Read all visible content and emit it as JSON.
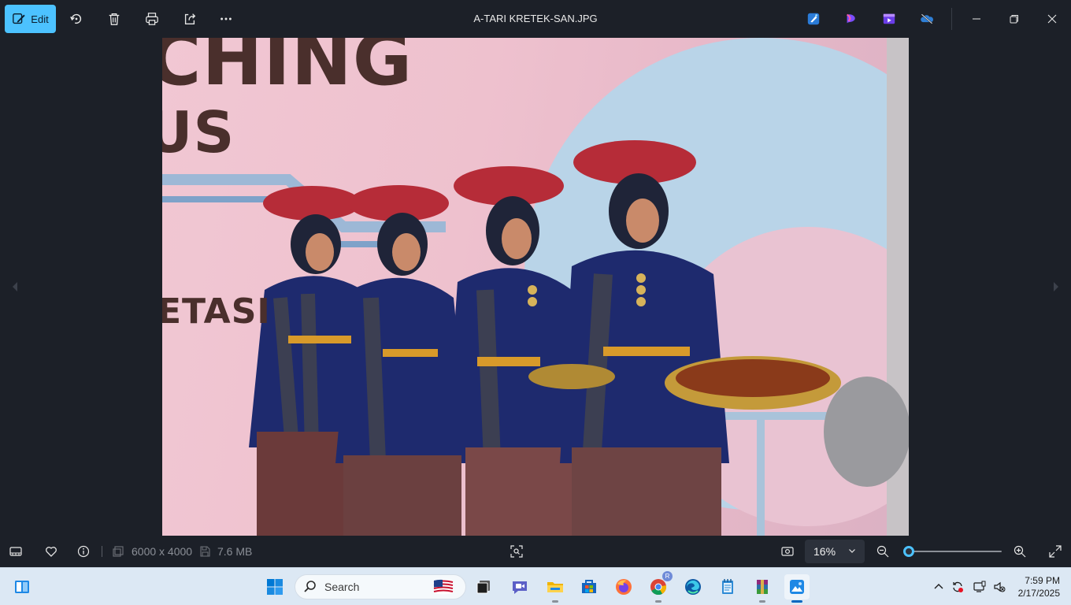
{
  "window": {
    "title": "A-TARI KRETEK-SAN.JPG",
    "edit_label": "Edit"
  },
  "toolbar": {
    "icons": [
      "edit-pencil-icon",
      "rotate-icon",
      "delete-icon",
      "print-icon",
      "share-icon",
      "more-icon"
    ]
  },
  "app_icons": [
    "designer-icon",
    "clipchamp-icon",
    "video-editor-icon",
    "onedrive-icon"
  ],
  "photo": {
    "banner_line1": "CHING",
    "banner_line2": "US",
    "banner_line3": "ETASI"
  },
  "status": {
    "dimensions": "6000 x 4000",
    "file_size": "7.6 MB",
    "zoom": "16%",
    "zoom_fraction": 0.02
  },
  "taskbar": {
    "search_placeholder": "Search",
    "chrome_badge": "R",
    "time": "7:59 PM",
    "date": "2/17/2025"
  },
  "colors": {
    "accent": "#4cc2ff",
    "background": "#1c2028",
    "taskbar": "#dce8f4"
  }
}
